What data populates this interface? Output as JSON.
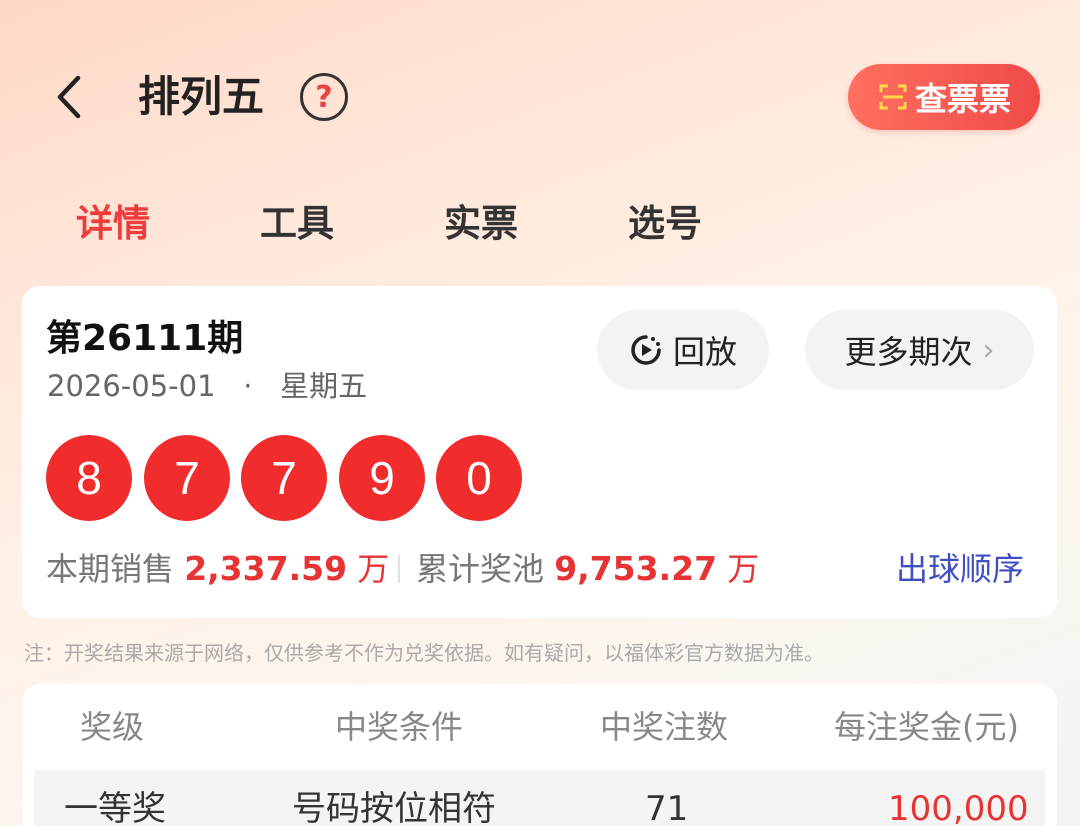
{
  "header": {
    "title": "排列五",
    "help_icon": "question-circle-icon",
    "check_ticket_label": "查票票",
    "check_ticket_icon": "scan-icon"
  },
  "tabs": [
    {
      "label": "详情",
      "active": true
    },
    {
      "label": "工具",
      "active": false
    },
    {
      "label": "实票",
      "active": false
    },
    {
      "label": "选号",
      "active": false
    }
  ],
  "draw": {
    "issue": "第26111期",
    "date": "2026-05-01",
    "separator": "·",
    "weekday": "星期五",
    "replay_label": "回放",
    "more_label": "更多期次",
    "numbers": [
      "8",
      "7",
      "7",
      "9",
      "0"
    ],
    "sales_label": "本期销售",
    "sales_value": "2,337.59",
    "sales_unit": "万",
    "pool_label": "累计奖池",
    "pool_value": "9,753.27",
    "pool_unit": "万",
    "order_link": "出球顺序"
  },
  "note": "注：开奖结果来源于网络，仅供参考不作为兑奖依据。如有疑问，以福体彩官方数据为准。",
  "prize_table": {
    "headers": [
      "奖级",
      "中奖条件",
      "中奖注数",
      "每注奖金(元)"
    ],
    "rows": [
      {
        "level": "一等奖",
        "condition": "号码按位相符",
        "count": "71",
        "prize": "100,000"
      }
    ]
  },
  "colors": {
    "accent_red": "#f03c3c",
    "link_blue": "#3f4fc2"
  }
}
